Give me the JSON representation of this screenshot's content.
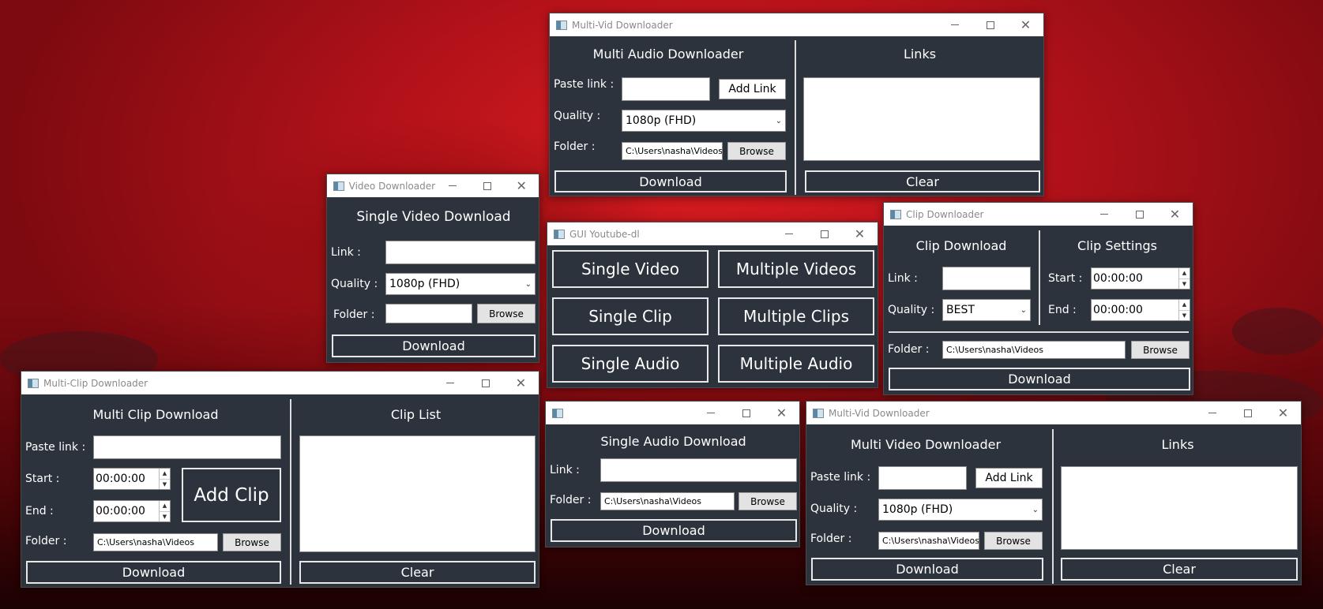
{
  "colors": {
    "window_bg": "#2c333d",
    "desktop": "#c4161c"
  },
  "multi_vid_audio": {
    "title": "Multi-Vid Downloader",
    "heading": "Multi Audio Downloader",
    "paste_label": "Paste link :",
    "add_link": "Add Link",
    "quality_label": "Quality :",
    "quality_value": "1080p (FHD)",
    "folder_label": "Folder :",
    "folder_value": "C:\\Users\\nasha\\Videos",
    "browse": "Browse",
    "download": "Download",
    "links_heading": "Links",
    "clear": "Clear"
  },
  "video_downloader": {
    "title": "Video Downloader",
    "heading": "Single Video Download",
    "link_label": "Link :",
    "quality_label": "Quality :",
    "quality_value": "1080p (FHD)",
    "folder_label": "Folder :",
    "browse": "Browse",
    "download": "Download"
  },
  "main_menu": {
    "title": "GUI Youtube-dl",
    "buttons": [
      "Single Video",
      "Multiple Videos",
      "Single Clip",
      "Multiple Clips",
      "Single Audio",
      "Multiple Audio"
    ]
  },
  "clip_downloader": {
    "title": "Clip Downloader",
    "heading": "Clip Download",
    "settings_heading": "Clip Settings",
    "link_label": "Link :",
    "quality_label": "Quality :",
    "quality_value": "BEST",
    "start_label": "Start :",
    "start_value": "00:00:00",
    "end_label": "End :",
    "end_value": "00:00:00",
    "folder_label": "Folder :",
    "folder_value": "C:\\Users\\nasha\\Videos",
    "browse": "Browse",
    "download": "Download"
  },
  "multi_clip": {
    "title": "Multi-Clip Downloader",
    "heading": "Multi Clip Download",
    "list_heading": "Clip List",
    "paste_label": "Paste link :",
    "start_label": "Start :",
    "start_value": "00:00:00",
    "end_label": "End :",
    "end_value": "00:00:00",
    "add_clip": "Add Clip",
    "folder_label": "Folder :",
    "folder_value": "C:\\Users\\nasha\\Videos",
    "browse": "Browse",
    "download": "Download",
    "clear": "Clear"
  },
  "audio_downloader": {
    "title": "",
    "heading": "Single Audio Download",
    "link_label": "Link :",
    "folder_label": "Folder :",
    "folder_value": "C:\\Users\\nasha\\Videos",
    "browse": "Browse",
    "download": "Download"
  },
  "multi_vid_video": {
    "title": "Multi-Vid Downloader",
    "heading": "Multi Video Downloader",
    "paste_label": "Paste link :",
    "add_link": "Add Link",
    "quality_label": "Quality :",
    "quality_value": "1080p (FHD)",
    "folder_label": "Folder :",
    "folder_value": "C:\\Users\\nasha\\Videos",
    "browse": "Browse",
    "download": "Download",
    "links_heading": "Links",
    "clear": "Clear"
  }
}
